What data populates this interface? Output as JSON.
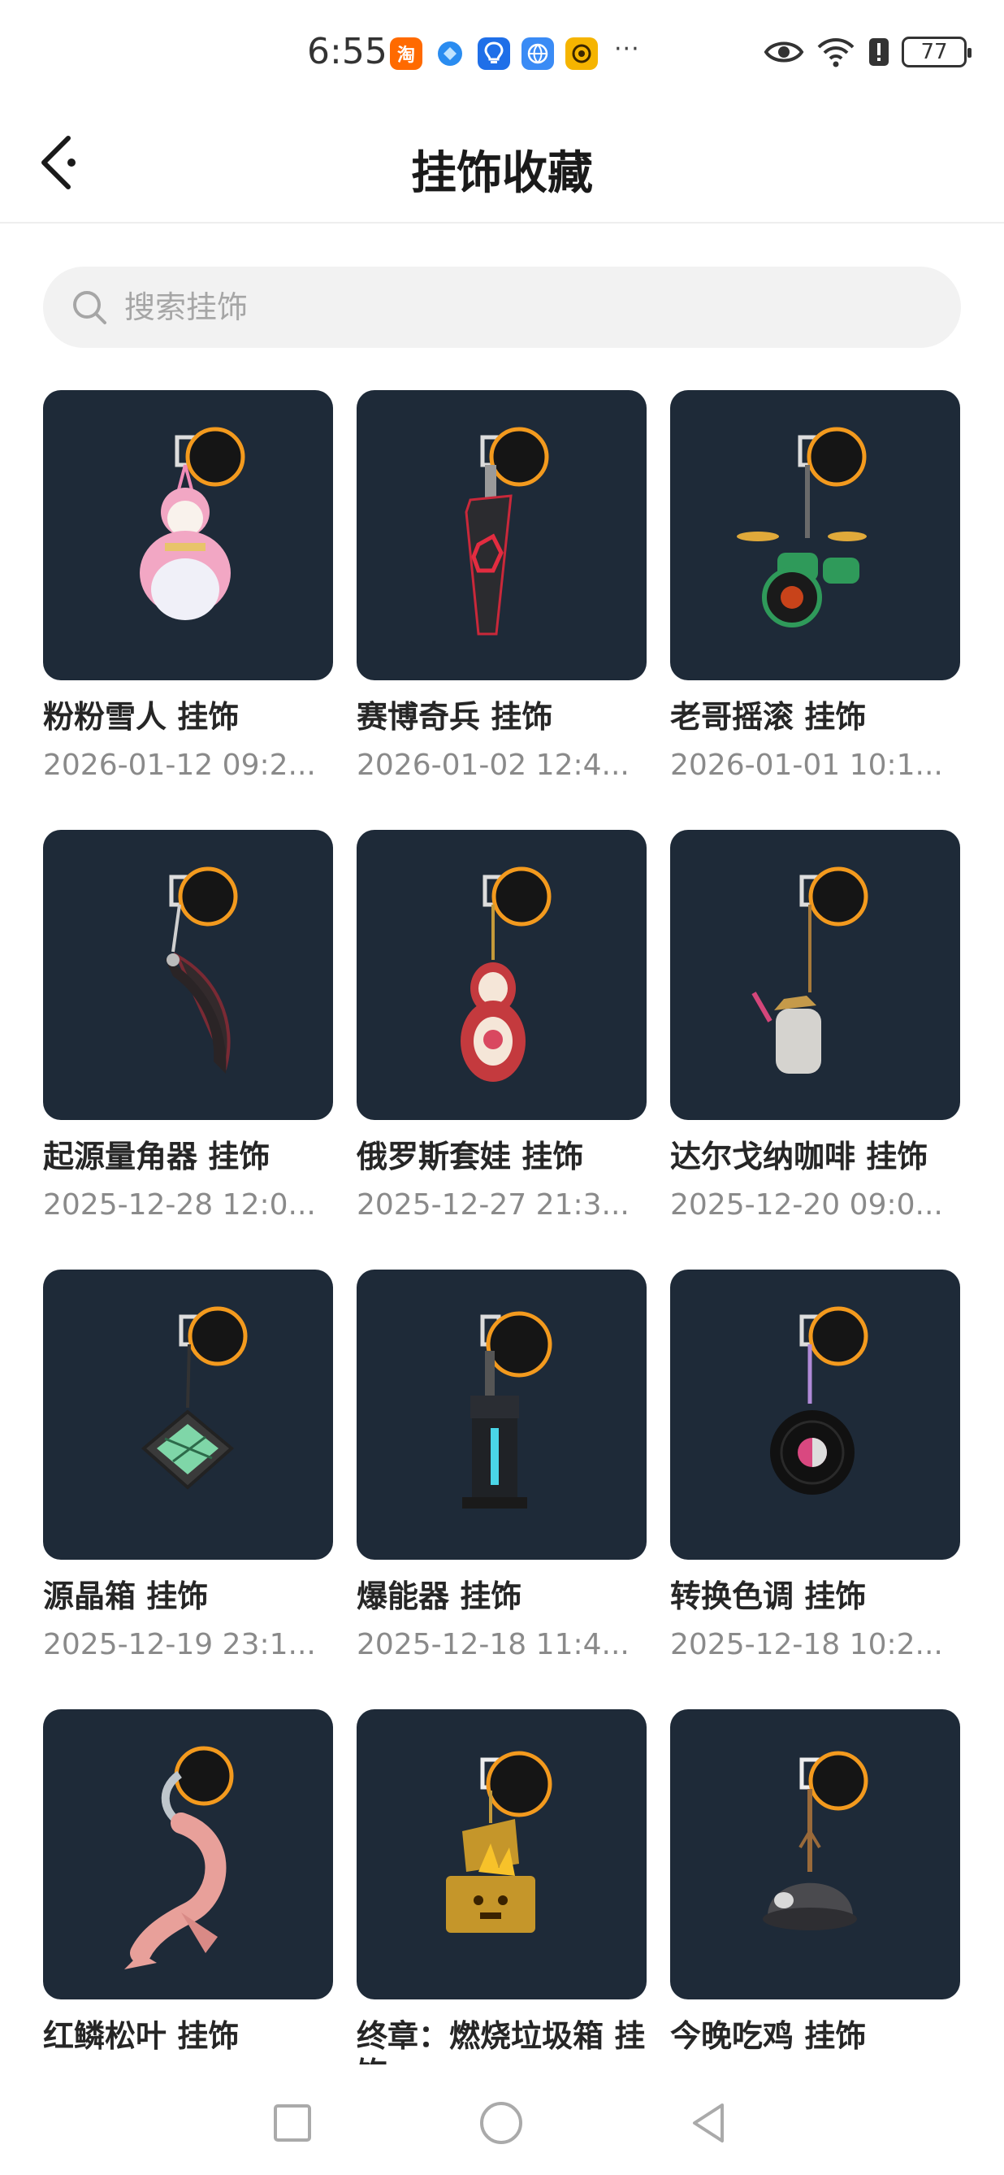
{
  "status_bar": {
    "time": "6:55",
    "battery": "77",
    "apps": [
      {
        "icon": "taobao-icon",
        "glyph": "淘",
        "color": "#ff6a00"
      },
      {
        "icon": "app-blue-icon",
        "glyph": "",
        "color": "#2a8cf0"
      },
      {
        "icon": "lightbulb-app-icon",
        "glyph": "",
        "color": "#1f6fe8"
      },
      {
        "icon": "browser-app-icon",
        "glyph": "",
        "color": "#3a8bf5"
      },
      {
        "icon": "camera-app-icon",
        "glyph": "",
        "color": "#f5b400"
      }
    ],
    "more": "···"
  },
  "header": {
    "title": "挂饰收藏"
  },
  "search": {
    "placeholder": "搜索挂饰"
  },
  "items": [
    {
      "title": "粉粉雪人 挂饰",
      "date": "2026-01-12 09:2...",
      "icon": "snowman-charm-icon"
    },
    {
      "title": "赛博奇兵 挂饰",
      "date": "2026-01-02 12:4...",
      "icon": "cyber-tag-charm-icon"
    },
    {
      "title": "老哥摇滚 挂饰",
      "date": "2026-01-01 10:1...",
      "icon": "drum-kit-charm-icon"
    },
    {
      "title": "起源量角器 挂饰",
      "date": "2025-12-28 12:0...",
      "icon": "protractor-charm-icon"
    },
    {
      "title": "俄罗斯套娃 挂饰",
      "date": "2025-12-27 21:3...",
      "icon": "matryoshka-charm-icon"
    },
    {
      "title": "达尔戈纳咖啡 挂饰",
      "date": "2025-12-20 09:0...",
      "icon": "coffee-cup-charm-icon"
    },
    {
      "title": "源晶箱 挂饰",
      "date": "2025-12-19 23:1...",
      "icon": "crystal-box-charm-icon"
    },
    {
      "title": "爆能器 挂饰",
      "date": "2025-12-18 11:4...",
      "icon": "blaster-charm-icon"
    },
    {
      "title": "转换色调 挂饰",
      "date": "2025-12-18 10:2...",
      "icon": "vinyl-record-charm-icon"
    },
    {
      "title": "红鳞松叶 挂饰",
      "date": "",
      "icon": "koi-fish-charm-icon"
    },
    {
      "title": "终章：燃烧垃圾箱 挂饰",
      "date": "",
      "icon": "burning-trash-bin-charm-icon"
    },
    {
      "title": "今晚吃鸡 挂饰",
      "date": "",
      "icon": "helmet-charm-icon"
    }
  ],
  "colors": {
    "thumb_bg": "#1e2a38",
    "accent_ring": "#f39a1e"
  }
}
